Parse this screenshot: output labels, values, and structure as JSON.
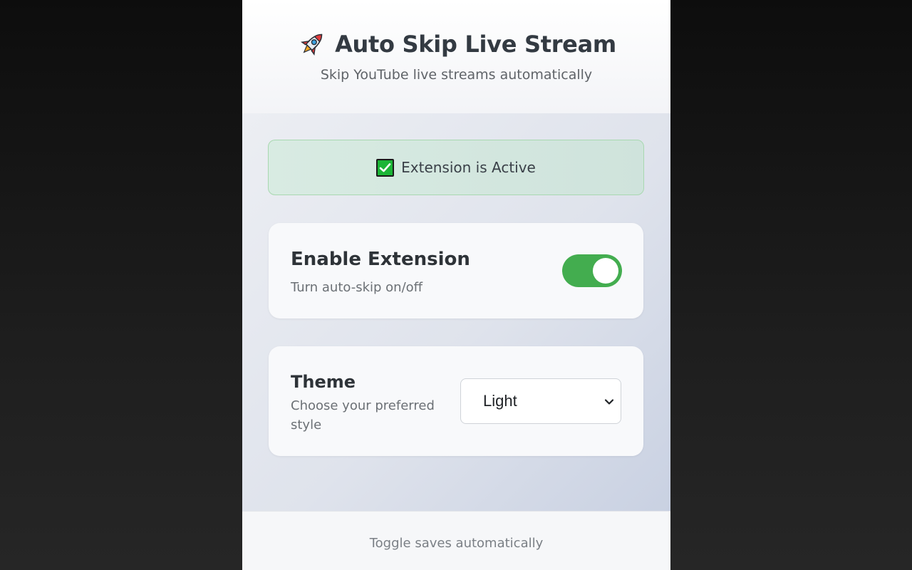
{
  "header": {
    "icon": "rocket-icon",
    "title": "Auto Skip Live Stream",
    "subtitle": "Skip YouTube live streams automatically"
  },
  "status": {
    "icon": "check-box-icon",
    "text": "Extension is Active",
    "color": "#1bb536"
  },
  "enable_card": {
    "title": "Enable Extension",
    "description": "Turn auto-skip on/off",
    "toggle_on": true,
    "toggle_color": "#43ad4f"
  },
  "theme_card": {
    "title": "Theme",
    "description": "Choose your preferred style",
    "selected": "Light"
  },
  "footer": {
    "text": "Toggle saves automatically"
  }
}
